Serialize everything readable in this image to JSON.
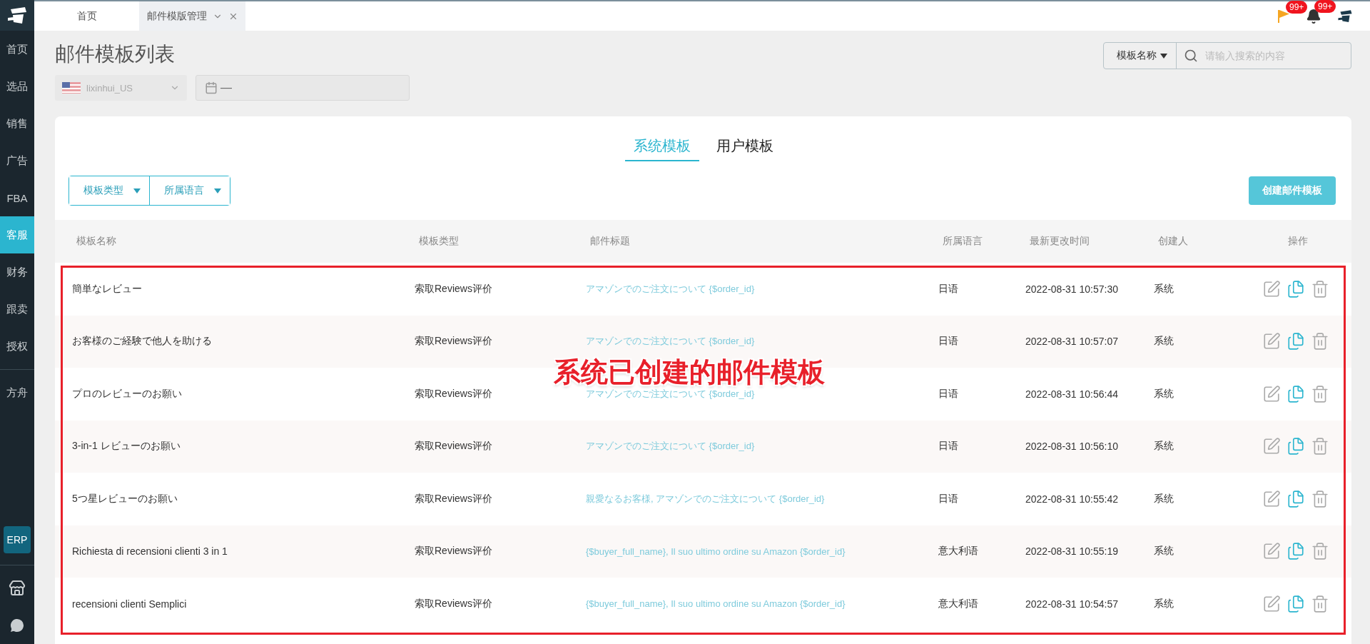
{
  "sidebar": {
    "items": [
      {
        "label": "首页",
        "selected": false
      },
      {
        "label": "选品",
        "selected": false
      },
      {
        "label": "销售",
        "selected": false
      },
      {
        "label": "广告",
        "selected": false
      },
      {
        "label": "FBA",
        "selected": false
      },
      {
        "label": "客服",
        "selected": true
      },
      {
        "label": "财务",
        "selected": false
      },
      {
        "label": "跟卖",
        "selected": false
      },
      {
        "label": "授权",
        "selected": false
      }
    ],
    "extra_items": [
      {
        "label": "方舟",
        "selected": false
      }
    ],
    "erp_badge": "ERP"
  },
  "tabs": [
    {
      "label": "首页",
      "selected": false,
      "closable": false
    },
    {
      "label": "邮件模版管理",
      "selected": true,
      "closable": true
    }
  ],
  "header": {
    "flag_badge": "99+",
    "bell_badge": "99+"
  },
  "page": {
    "title": "邮件模板列表",
    "store": "lixinhui_US",
    "date_separator": "—",
    "search": {
      "field": "模板名称",
      "placeholder": "请输入搜索的内容"
    }
  },
  "template_tabs": [
    {
      "label": "系统模板",
      "selected": true
    },
    {
      "label": "用户模板",
      "selected": false
    }
  ],
  "filters": [
    "模板类型",
    "所属语言"
  ],
  "create_button": "创建邮件模板",
  "table": {
    "columns": [
      "模板名称",
      "模板类型",
      "邮件标题",
      "所属语言",
      "最新更改时间",
      "创建人",
      "操作"
    ],
    "rows": [
      {
        "name": "簡単なレビュー",
        "type": "索取Reviews评价",
        "subject": "アマゾンでのご注文について {$order_id}",
        "language": "日语",
        "updated": "2022-08-31 10:57:30",
        "creator": "系统"
      },
      {
        "name": "お客様のご経験で他人を助ける",
        "type": "索取Reviews评价",
        "subject": "アマゾンでのご注文について {$order_id}",
        "language": "日语",
        "updated": "2022-08-31 10:57:07",
        "creator": "系统"
      },
      {
        "name": "プロのレビューのお願い",
        "type": "索取Reviews评价",
        "subject": "アマゾンでのご注文について {$order_id}",
        "language": "日语",
        "updated": "2022-08-31 10:56:44",
        "creator": "系统"
      },
      {
        "name": "3-in-1 レビューのお願い",
        "type": "索取Reviews评价",
        "subject": "アマゾンでのご注文について {$order_id}",
        "language": "日语",
        "updated": "2022-08-31 10:56:10",
        "creator": "系统"
      },
      {
        "name": "5つ星レビューのお願い",
        "type": "索取Reviews评价",
        "subject": "親愛なるお客様, アマゾンでのご注文について {$order_id}",
        "language": "日语",
        "updated": "2022-08-31 10:55:42",
        "creator": "系统"
      },
      {
        "name": "Richiesta di recensioni clienti 3 in 1",
        "type": "索取Reviews评价",
        "subject": "{$buyer_full_name}, Il suo ultimo ordine su Amazon {$order_id}",
        "language": "意大利语",
        "updated": "2022-08-31 10:55:19",
        "creator": "系统"
      },
      {
        "name": "recensioni clienti Semplici",
        "type": "索取Reviews评价",
        "subject": "{$buyer_full_name}, Il suo ultimo ordine su Amazon {$order_id}",
        "language": "意大利语",
        "updated": "2022-08-31 10:54:57",
        "creator": "系统"
      }
    ]
  },
  "annotation": {
    "text": "系统已创建的邮件模板"
  }
}
